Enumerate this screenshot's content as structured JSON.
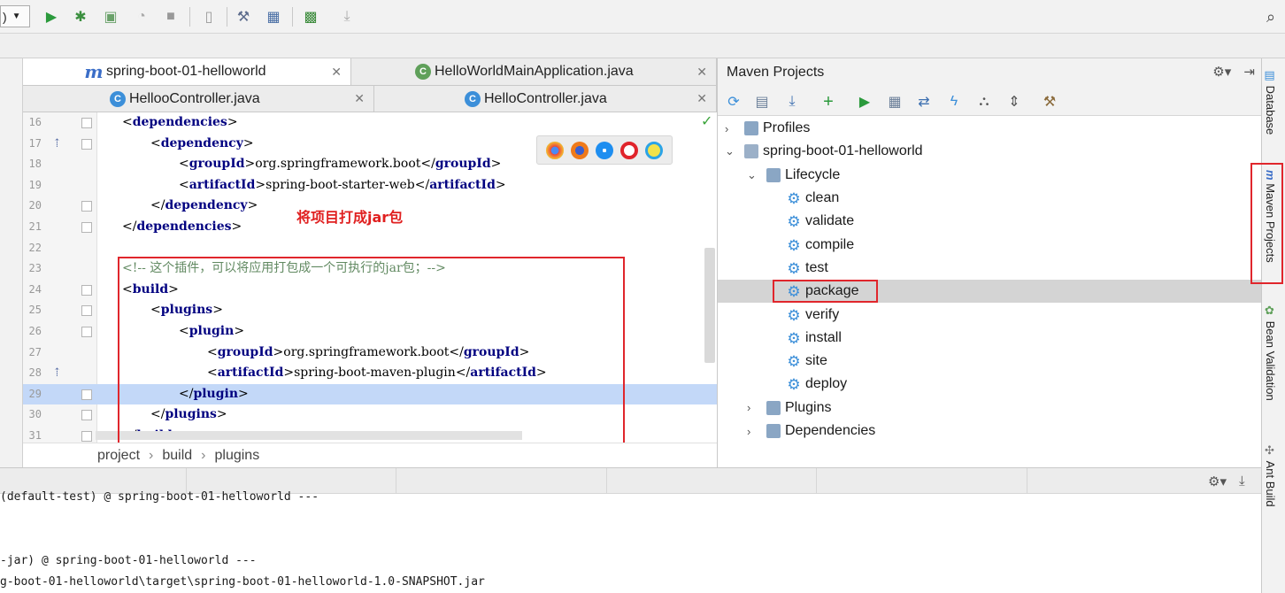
{
  "toolbar": {
    "run_config_label": ")",
    "icons": [
      "run-icon",
      "debug-icon",
      "coverage-icon",
      "profile-icon",
      "stop-icon",
      "build-artifact-icon",
      "project-structure-icon",
      "sdk-icon",
      "maven-icon",
      "download-icon",
      "search-icon"
    ]
  },
  "tabs": {
    "row1": [
      {
        "label": "spring-boot-01-helloworld",
        "icon": "m",
        "active": true
      },
      {
        "label": "HelloWorldMainApplication.java",
        "icon": "sb",
        "active": false
      }
    ],
    "row2": [
      {
        "label": "HellooController.java",
        "icon": "c"
      },
      {
        "label": "HelloController.java",
        "icon": "c"
      }
    ]
  },
  "editor": {
    "lines": [
      {
        "num": "16",
        "indent": 0,
        "html": [
          [
            "b",
            "<"
          ],
          [
            "t",
            "dependencies"
          ],
          [
            "b",
            ">"
          ]
        ]
      },
      {
        "num": "17",
        "indent": 1,
        "html": [
          [
            "b",
            "<"
          ],
          [
            "t",
            "dependency"
          ],
          [
            "b",
            ">"
          ]
        ]
      },
      {
        "num": "18",
        "indent": 2,
        "html": [
          [
            "b",
            "<"
          ],
          [
            "t",
            "groupId"
          ],
          [
            "b",
            ">"
          ],
          [
            "x",
            "org.springframework.boot"
          ],
          [
            "b",
            "</"
          ],
          [
            "t",
            "groupId"
          ],
          [
            "b",
            ">"
          ]
        ]
      },
      {
        "num": "19",
        "indent": 2,
        "html": [
          [
            "b",
            "<"
          ],
          [
            "t",
            "artifactId"
          ],
          [
            "b",
            ">"
          ],
          [
            "x",
            "spring-boot-starter-web"
          ],
          [
            "b",
            "</"
          ],
          [
            "t",
            "artifactId"
          ],
          [
            "b",
            ">"
          ]
        ]
      },
      {
        "num": "20",
        "indent": 1,
        "html": [
          [
            "b",
            "</"
          ],
          [
            "t",
            "dependency"
          ],
          [
            "b",
            ">"
          ]
        ]
      },
      {
        "num": "21",
        "indent": 0,
        "html": [
          [
            "b",
            "</"
          ],
          [
            "t",
            "dependencies"
          ],
          [
            "b",
            ">"
          ]
        ]
      },
      {
        "num": "22",
        "indent": 0,
        "html": []
      },
      {
        "num": "23",
        "indent": 0,
        "html": [
          [
            "c",
            "<!-- 这个插件，可以将应用打包成一个可执行的jar包；-->"
          ]
        ]
      },
      {
        "num": "24",
        "indent": 0,
        "html": [
          [
            "b",
            "<"
          ],
          [
            "t",
            "build"
          ],
          [
            "b",
            ">"
          ]
        ]
      },
      {
        "num": "25",
        "indent": 1,
        "html": [
          [
            "b",
            "<"
          ],
          [
            "t",
            "plugins"
          ],
          [
            "b",
            ">"
          ]
        ]
      },
      {
        "num": "26",
        "indent": 2,
        "html": [
          [
            "b",
            "<"
          ],
          [
            "t",
            "plugin"
          ],
          [
            "b",
            ">"
          ]
        ]
      },
      {
        "num": "27",
        "indent": 3,
        "html": [
          [
            "b",
            "<"
          ],
          [
            "t",
            "groupId"
          ],
          [
            "b",
            ">"
          ],
          [
            "x",
            "org.springframework.boot"
          ],
          [
            "b",
            "</"
          ],
          [
            "t",
            "groupId"
          ],
          [
            "b",
            ">"
          ]
        ]
      },
      {
        "num": "28",
        "indent": 3,
        "html": [
          [
            "b",
            "<"
          ],
          [
            "t",
            "artifactId"
          ],
          [
            "b",
            ">"
          ],
          [
            "x",
            "spring-boot-maven-plugin"
          ],
          [
            "b",
            "</"
          ],
          [
            "t",
            "artifactId"
          ],
          [
            "b",
            ">"
          ]
        ]
      },
      {
        "num": "29",
        "indent": 2,
        "html": [
          [
            "b",
            "</"
          ],
          [
            "t",
            "plugin"
          ],
          [
            "b",
            ">"
          ]
        ],
        "highlight": true
      },
      {
        "num": "30",
        "indent": 1,
        "html": [
          [
            "b",
            "</"
          ],
          [
            "t",
            "plugins"
          ],
          [
            "b",
            ">"
          ]
        ]
      },
      {
        "num": "31",
        "indent": 0,
        "html": [
          [
            "b",
            "</"
          ],
          [
            "t",
            "build"
          ],
          [
            "b",
            ">"
          ]
        ]
      }
    ],
    "annotation": "将项目打成jar包"
  },
  "breadcrumb": [
    "project",
    "build",
    "plugins"
  ],
  "maven": {
    "title": "Maven Projects",
    "tree": [
      {
        "label": "Profiles",
        "level": 0,
        "type": "folder",
        "chev": "›"
      },
      {
        "label": "spring-boot-01-helloworld",
        "level": 0,
        "type": "module",
        "chev": "⌄"
      },
      {
        "label": "Lifecycle",
        "level": 1,
        "type": "folder",
        "chev": "⌄"
      },
      {
        "label": "clean",
        "level": 2,
        "type": "gear"
      },
      {
        "label": "validate",
        "level": 2,
        "type": "gear"
      },
      {
        "label": "compile",
        "level": 2,
        "type": "gear"
      },
      {
        "label": "test",
        "level": 2,
        "type": "gear"
      },
      {
        "label": "package",
        "level": 2,
        "type": "gear",
        "selected": true
      },
      {
        "label": "verify",
        "level": 2,
        "type": "gear"
      },
      {
        "label": "install",
        "level": 2,
        "type": "gear"
      },
      {
        "label": "site",
        "level": 2,
        "type": "gear"
      },
      {
        "label": "deploy",
        "level": 2,
        "type": "gear"
      },
      {
        "label": "Plugins",
        "level": 1,
        "type": "folder",
        "chev": "›"
      },
      {
        "label": "Dependencies",
        "level": 1,
        "type": "folder",
        "chev": "›"
      }
    ]
  },
  "side_tabs": {
    "database": "Database",
    "maven_projects": "Maven Projects",
    "bean_validation": "Bean Validation",
    "ant_build": "Ant Build"
  },
  "console": {
    "lines": [
      "(default-test) @ spring-boot-01-helloworld ---",
      "",
      "",
      "-jar) @ spring-boot-01-helloworld ---",
      "g-boot-01-helloworld\\target\\spring-boot-01-helloworld-1.0-SNAPSHOT.jar"
    ]
  },
  "colors": {
    "tag": "#000080",
    "comment": "#628a62",
    "annotation_red": "#e02020",
    "highlight": "#c3d8f8",
    "selected_row": "#d4d4d4"
  }
}
